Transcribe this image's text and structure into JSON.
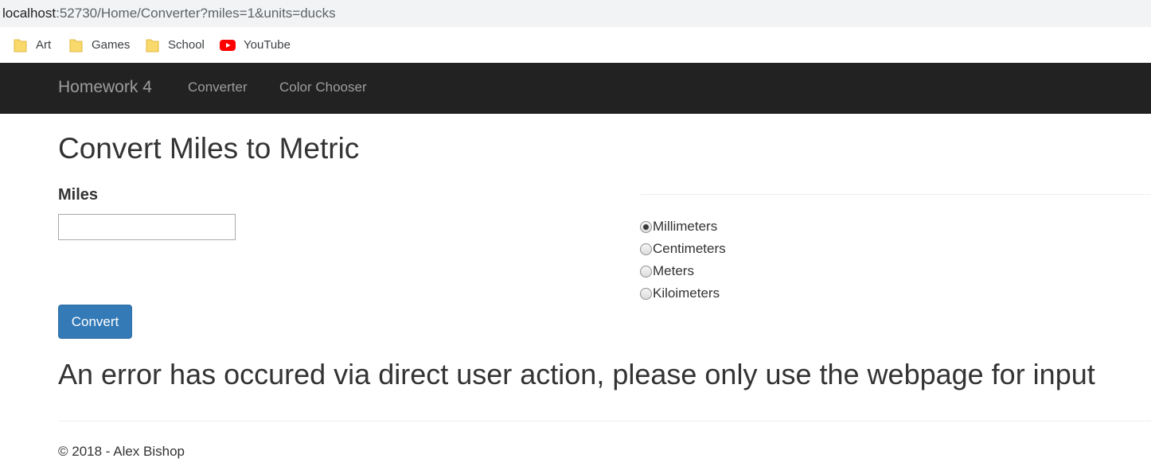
{
  "browser": {
    "url_host": "localhost",
    "url_rest": ":52730/Home/Converter?miles=1&units=ducks",
    "bookmarks": [
      {
        "label": "Art",
        "icon": "folder-icon"
      },
      {
        "label": "Games",
        "icon": "folder-icon"
      },
      {
        "label": "School",
        "icon": "folder-icon"
      },
      {
        "label": "YouTube",
        "icon": "youtube-icon"
      }
    ]
  },
  "navbar": {
    "brand": "Homework 4",
    "links": [
      "Converter",
      "Color Chooser"
    ],
    "background": "#222222"
  },
  "main": {
    "title": "Convert Miles to Metric",
    "miles_label": "Miles",
    "miles_value": "",
    "units": [
      {
        "label": "Millimeters",
        "checked": true
      },
      {
        "label": "Centimeters",
        "checked": false
      },
      {
        "label": "Meters",
        "checked": false
      },
      {
        "label": "Kiloimeters",
        "checked": false
      }
    ],
    "convert_label": "Convert",
    "button_color": "#337ab7",
    "error_message": "An error has occured via direct user action, please only use the webpage for input"
  },
  "footer": {
    "text": "© 2018 - Alex Bishop"
  }
}
